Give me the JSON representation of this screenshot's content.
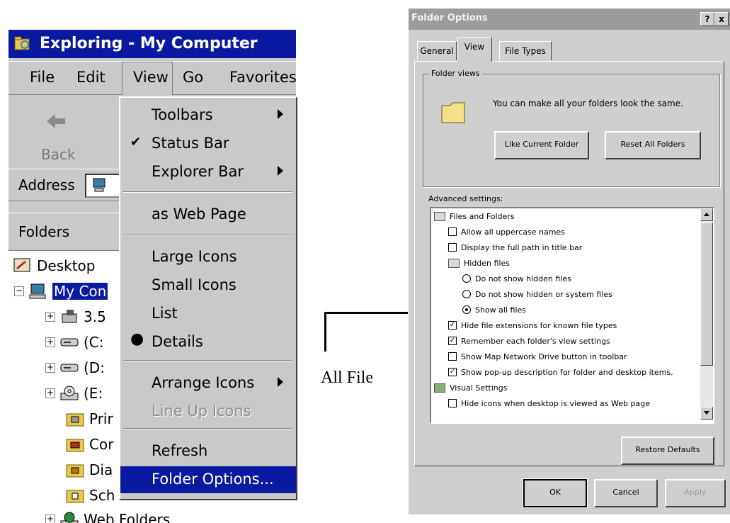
{
  "explorer": {
    "title": "Exploring - My Computer",
    "menu": {
      "file": "File",
      "edit": "Edit",
      "view": "View",
      "go": "Go",
      "favorites": "Favorites"
    },
    "toolbar": {
      "back": "Back"
    },
    "address_label": "Address",
    "folders_label": "Folders",
    "tree": [
      {
        "label": "Desktop",
        "icon": "desktop-icon"
      },
      {
        "label": "My Con",
        "icon": "computer-icon",
        "selected": true
      },
      {
        "label": "3.5",
        "icon": "floppy-drive-icon"
      },
      {
        "label": "(C:",
        "icon": "hard-drive-icon"
      },
      {
        "label": "(D:",
        "icon": "hard-drive-icon"
      },
      {
        "label": "(E:",
        "icon": "cd-drive-icon"
      },
      {
        "label": "Prir",
        "icon": "printers-folder-icon"
      },
      {
        "label": "Cor",
        "icon": "control-panel-folder-icon"
      },
      {
        "label": "Dia",
        "icon": "dialup-folder-icon"
      },
      {
        "label": "Sch",
        "icon": "scheduled-tasks-folder-icon"
      },
      {
        "label": "Web Folders",
        "icon": "web-folders-icon"
      }
    ]
  },
  "view_menu": {
    "toolbars": "Toolbars",
    "status_bar": "Status Bar",
    "explorer_bar": "Explorer Bar",
    "as_web_page": "as Web Page",
    "large_icons": "Large Icons",
    "small_icons": "Small Icons",
    "list": "List",
    "details": "Details",
    "arrange_icons": "Arrange Icons",
    "line_up_icons": "Line Up Icons",
    "refresh": "Refresh",
    "folder_options": "Folder Options..."
  },
  "callout": {
    "text": "All File"
  },
  "dialog": {
    "title": "Folder Options",
    "help_btn": "?",
    "close_btn": "x",
    "tabs": {
      "general": "General",
      "view": "View",
      "file_types": "File Types"
    },
    "folder_views": {
      "group_label": "Folder views",
      "description": "You can make all your folders look the same.",
      "like_current": "Like Current Folder",
      "reset_all": "Reset All Folders"
    },
    "advanced_label": "Advanced settings:",
    "advanced": {
      "files_and_folders": "Files and Folders",
      "allow_uppercase": "Allow all uppercase names",
      "display_full_path": "Display the full path in title bar",
      "hidden_files": "Hidden files",
      "do_not_show_hidden": "Do not show hidden files",
      "do_not_show_hidden_system": "Do not show hidden or system files",
      "show_all_files": "Show all files",
      "hide_extensions": "Hide file extensions for known file types",
      "remember_view": "Remember each folder's view settings",
      "show_map_network": "Show Map Network Drive button in toolbar",
      "show_popup": "Show pop-up description for folder and desktop items.",
      "visual_settings": "Visual Settings",
      "hide_icons_web": "Hide icons when desktop is viewed as Web page"
    },
    "restore_defaults": "Restore Defaults",
    "ok": "OK",
    "cancel": "Cancel",
    "apply": "Apply"
  },
  "colors": {
    "titlebar": "#0a1aa0",
    "menu_bg": "#c9c9c9",
    "dialog_bg": "#cfcfcf"
  }
}
